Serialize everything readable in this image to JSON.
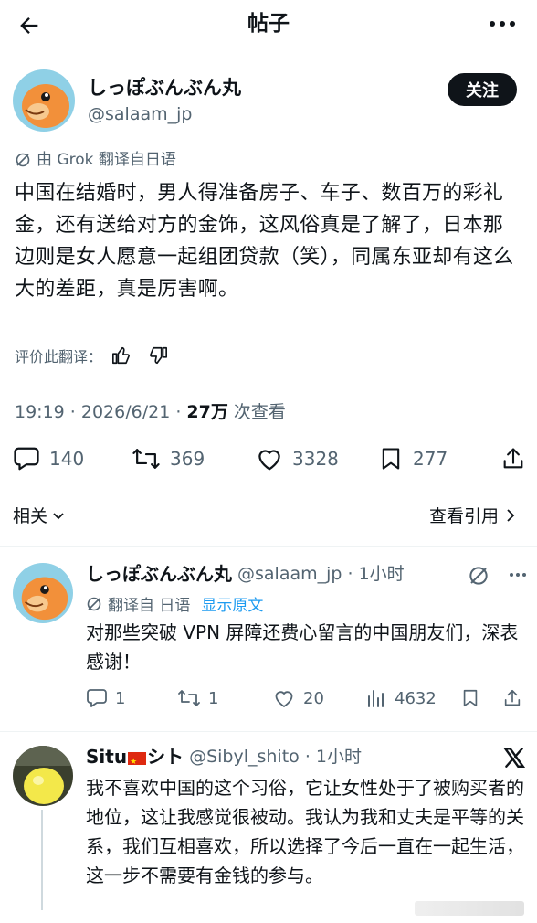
{
  "header": {
    "title": "帖子"
  },
  "post": {
    "author_name": "しっぽぶんぶん丸",
    "handle": "@salaam_jp",
    "follow_label": "关注",
    "translated_by": "由 Grok 翻译自日语",
    "text": "中国在结婚时，男人得准备房子、车子、数百万的彩礼金，还有送给对方的金饰，这风俗真是了解了，日本那边则是女人愿意一起组团贷款（笑），同属东亚却有这么大的差距，真是厉害啊。",
    "rate_label": "评价此翻译：",
    "time": "19:19 · 2026/6/21 · ",
    "views_count": "27万",
    "views_label": " 次查看",
    "stats": {
      "replies": "140",
      "reposts": "369",
      "likes": "3328",
      "bookmarks": "277"
    }
  },
  "related": {
    "label": "相关",
    "quotes_label": "查看引用"
  },
  "reply1": {
    "author_name": "しっぽぶんぶん丸",
    "meta": "@salaam_jp · 1小时",
    "translated_from": "翻译自 日语",
    "show_original": "显示原文",
    "text": "对那些突破 VPN 屏障还费心留言的中国朋友们，深表感谢！",
    "stats": {
      "replies": "1",
      "reposts": "1",
      "likes": "20",
      "views": "4632"
    }
  },
  "reply2": {
    "author_prefix": "Situ",
    "author_suffix": "シト",
    "meta": "@Sibyl_shito · 1小时",
    "text": "我不喜欢中国的这个习俗，它让女性处于了被购买者的地位，这让我感觉很被动。我认为我和丈夫是平等的关系，我们互相喜欢，所以选择了今后一直在一起生活，这一步不需要有金钱的参与。"
  },
  "colors": {
    "accent": "#1d9bf0",
    "text": "#0f1419",
    "muted": "#536471"
  }
}
